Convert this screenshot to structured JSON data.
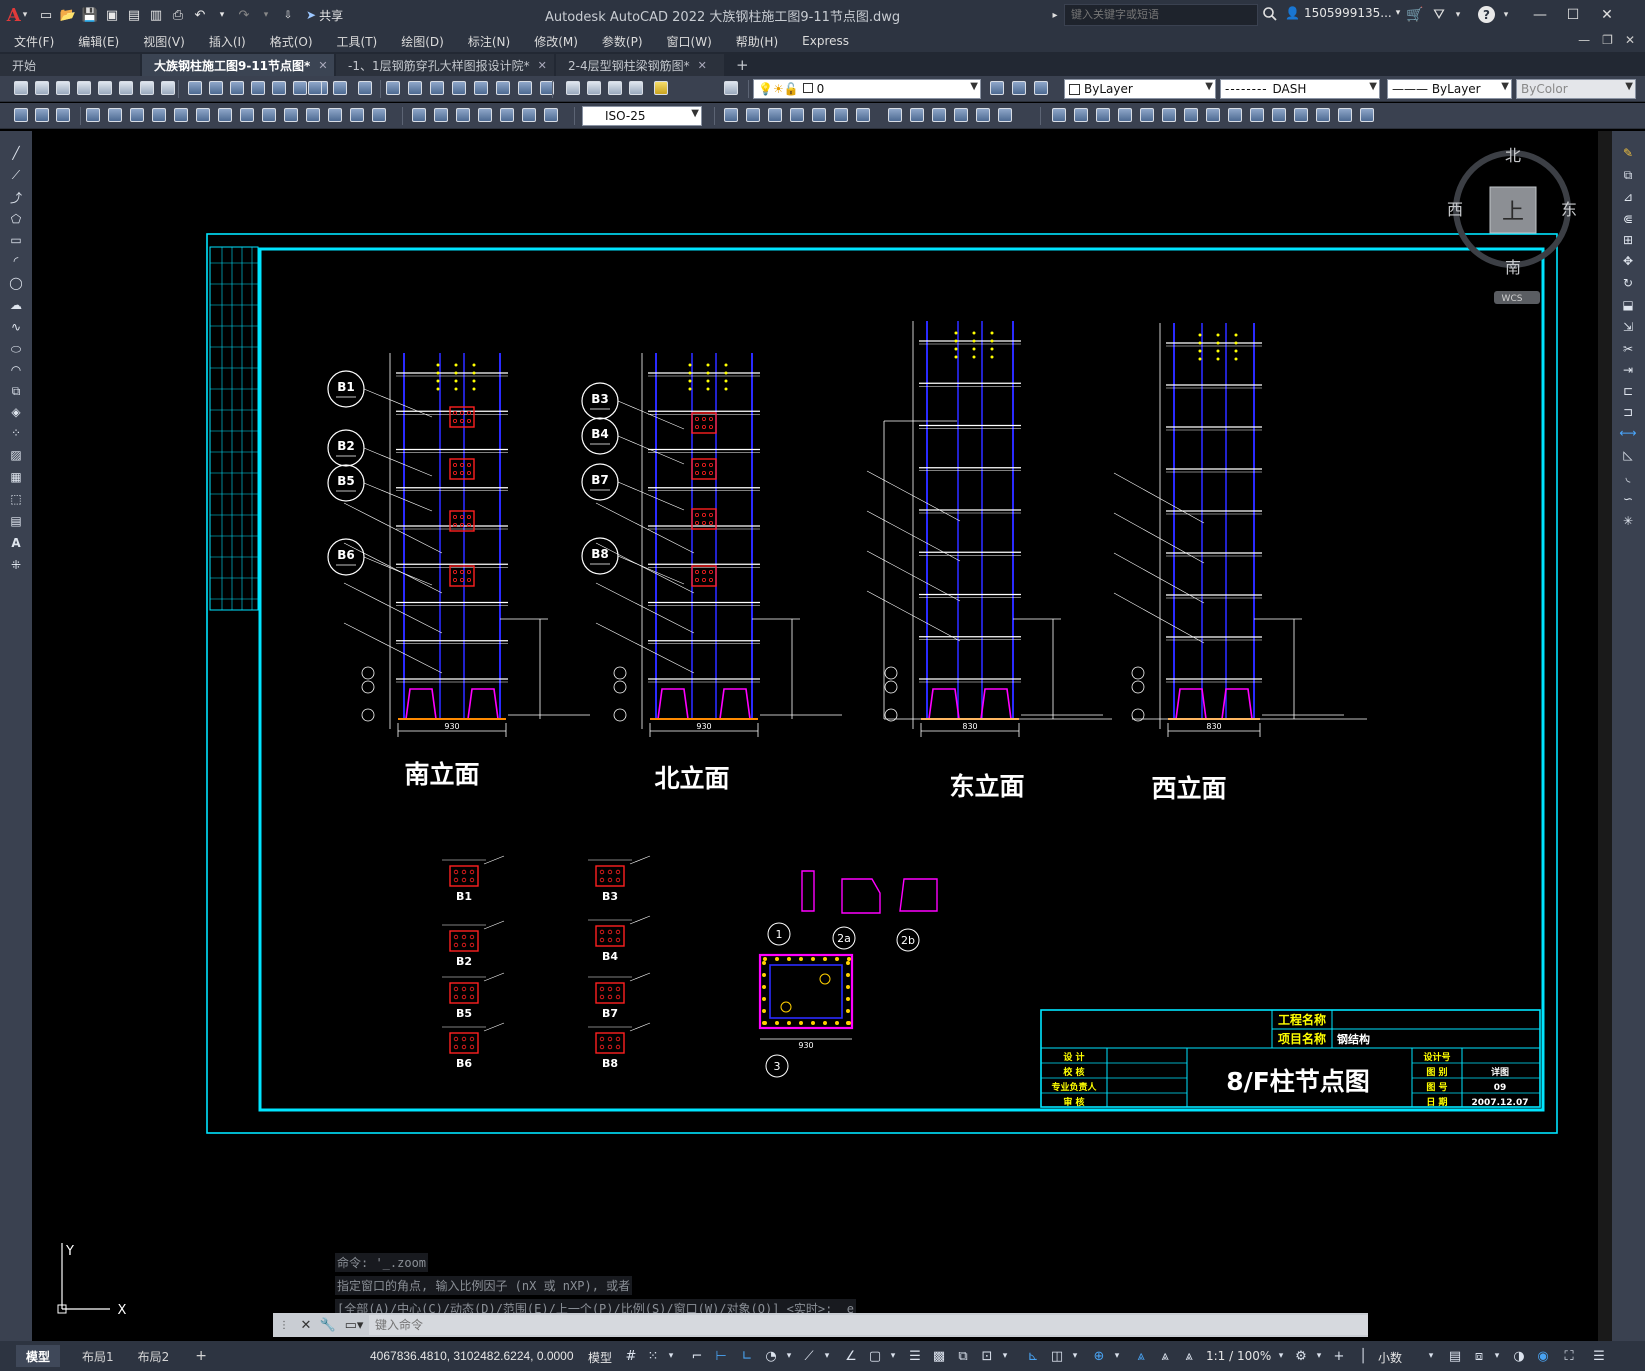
{
  "app": {
    "logo": "A",
    "title": "Autodesk AutoCAD 2022    大族钢柱施工图9-11节点图.dwg",
    "search_placeholder": "键入关键字或短语",
    "user": "1505999135...",
    "share_label": "共享"
  },
  "menu": [
    "文件(F)",
    "编辑(E)",
    "视图(V)",
    "插入(I)",
    "格式(O)",
    "工具(T)",
    "绘图(D)",
    "标注(N)",
    "修改(M)",
    "参数(P)",
    "窗口(W)",
    "帮助(H)",
    "Express"
  ],
  "file_tabs": [
    {
      "label": "开始",
      "active": false,
      "closable": false
    },
    {
      "label": "大族钢柱施工图9-11节点图*",
      "active": true,
      "closable": true
    },
    {
      "label": "-1、1层钢筋穿孔大样图报设计院*",
      "active": false,
      "closable": true
    },
    {
      "label": "2-4层型钢柱梁钢筋图*",
      "active": false,
      "closable": true
    }
  ],
  "new_tab_label": "+",
  "properties": {
    "layer": "0",
    "color": "ByLayer",
    "linetype": "DASH",
    "lineweight": "ByLayer",
    "plotstyle": "ByColor",
    "dimstyle": "ISO-25"
  },
  "viewcube": {
    "north": "北",
    "south": "南",
    "east": "东",
    "west": "西",
    "face": "上",
    "wcs": "WCS"
  },
  "drawing": {
    "views": [
      {
        "id": "south",
        "title": "南立面"
      },
      {
        "id": "north",
        "title": "北立面"
      },
      {
        "id": "east",
        "title": "东立面"
      },
      {
        "id": "west",
        "title": "西立面"
      }
    ],
    "bubbles": [
      "B1",
      "B2",
      "B5",
      "B6",
      "B3",
      "B4",
      "B7",
      "B8"
    ],
    "details": [
      "B1",
      "B2",
      "B5",
      "B6",
      "B3",
      "B4",
      "B7",
      "B8"
    ],
    "detail_numbers": [
      "1",
      "2a",
      "2b",
      "3"
    ],
    "width_labels": [
      "930",
      "930",
      "830",
      "830"
    ],
    "titleblock": {
      "project_label": "工程名称",
      "item_label": "项目名称",
      "item_value": "钢结构",
      "drawing_title": "8/F柱节点图",
      "roles": [
        "设 计",
        "校 核",
        "专业负责人",
        "审 核"
      ],
      "fields": [
        {
          "label": "设计号",
          "value": ""
        },
        {
          "label": "图 别",
          "value": "详图"
        },
        {
          "label": "图 号",
          "value": "09"
        },
        {
          "label": "日 期",
          "value": "2007.12.07"
        }
      ]
    }
  },
  "ucs": {
    "x": "X",
    "y": "Y"
  },
  "command": {
    "history": [
      "命令: '_.zoom",
      "指定窗口的角点, 输入比例因子 (nX 或 nXP), 或者",
      "[全部(A)/中心(C)/动态(D)/范围(E)/上一个(P)/比例(S)/窗口(W)/对象(O)] <实时>: _e"
    ],
    "placeholder": "键入命令"
  },
  "status": {
    "layout_tabs": [
      "模型",
      "布局1",
      "布局2"
    ],
    "add_layout": "+",
    "coords": "4067836.4810, 3102482.6224, 0.0000",
    "model_label": "模型",
    "scale": "1:1 / 100%",
    "units": "小数"
  },
  "colors": {
    "titlebar_bg": "#2d3441",
    "toolbar_bg": "#3a4150",
    "canvas_bg": "#000000",
    "frame_cyan": "#00e5ff",
    "column_blue": "#2a2aff",
    "plate_magenta": "#ff00ff",
    "bolt_red": "#ff2020",
    "text_white": "#ffffff",
    "text_yellow": "#ffff00"
  }
}
